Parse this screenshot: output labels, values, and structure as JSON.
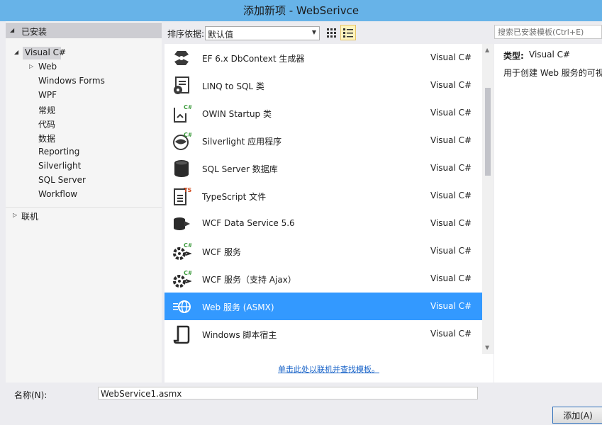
{
  "window": {
    "title": "添加新项 - WebSerivce"
  },
  "left_panel": {
    "installed_label": "已安装",
    "root_node": "Visual C#",
    "children": [
      "Web",
      "Windows Forms",
      "WPF",
      "常规",
      "代码",
      "数据",
      "Reporting",
      "Silverlight",
      "SQL Server",
      "Workflow"
    ],
    "online_label": "联机"
  },
  "toolbar": {
    "sort_label": "排序依据:",
    "sort_value": "默认值"
  },
  "search": {
    "placeholder": "搜索已安装模板(Ctrl+E)"
  },
  "templates": [
    {
      "name": "EF 6.x DbContext 生成器",
      "lang": "Visual C#",
      "icon": "ef-generator-icon"
    },
    {
      "name": "LINQ to SQL 类",
      "lang": "Visual C#",
      "icon": "linq-sql-icon"
    },
    {
      "name": "OWIN Startup 类",
      "lang": "Visual C#",
      "icon": "owin-startup-icon"
    },
    {
      "name": "Silverlight 应用程序",
      "lang": "Visual C#",
      "icon": "silverlight-app-icon"
    },
    {
      "name": "SQL Server 数据库",
      "lang": "Visual C#",
      "icon": "database-icon"
    },
    {
      "name": "TypeScript 文件",
      "lang": "Visual C#",
      "icon": "typescript-file-icon"
    },
    {
      "name": "WCF Data Service 5.6",
      "lang": "Visual C#",
      "icon": "wcf-data-service-icon"
    },
    {
      "name": "WCF 服务",
      "lang": "Visual C#",
      "icon": "wcf-service-icon"
    },
    {
      "name": "WCF 服务（支持 Ajax）",
      "lang": "Visual C#",
      "icon": "wcf-ajax-service-icon"
    },
    {
      "name": "Web 服务 (ASMX)",
      "lang": "Visual C#",
      "icon": "web-service-globe-icon",
      "selected": true
    },
    {
      "name": "Windows 脚本宿主",
      "lang": "Visual C#",
      "icon": "script-host-icon"
    }
  ],
  "online_link": "单击此处以联机并查找模板。",
  "details": {
    "type_label": "类型:",
    "type_value": "Visual C#",
    "description": "用于创建 Web 服务的可视设"
  },
  "bottom": {
    "name_label": "名称(N):",
    "name_value": "WebService1.asmx",
    "add_button": "添加(A)"
  },
  "colors": {
    "titlebar": "#67b3e8",
    "selection": "#3399ff",
    "link": "#1a64c8"
  }
}
